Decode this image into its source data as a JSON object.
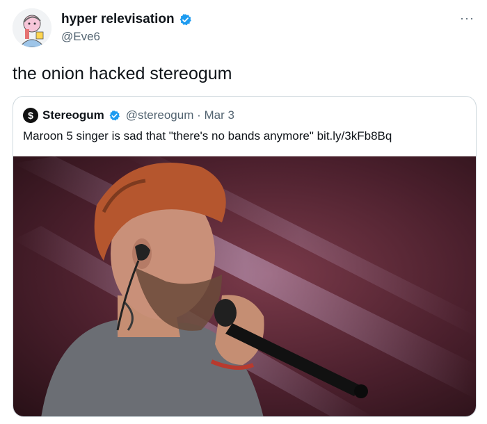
{
  "author": {
    "display_name": "hyper relevisation",
    "handle": "@Eve6",
    "avatar_icon": "person-illustration-avatar"
  },
  "tweet": {
    "text": "the onion hacked stereogum",
    "more_icon": "more-options-icon"
  },
  "quote": {
    "display_name": "Stereogum",
    "avatar_letter": "$",
    "handle_date": "@stereogum · Mar 3",
    "text": "Maroon 5 singer is sad that \"there's no bands anymore\" bit.ly/3kFb8Bq",
    "media_icon": "singer-photo-image"
  },
  "colors": {
    "verified": "#1d9bf0",
    "text_secondary": "#536471",
    "border": "#cfd9de"
  }
}
